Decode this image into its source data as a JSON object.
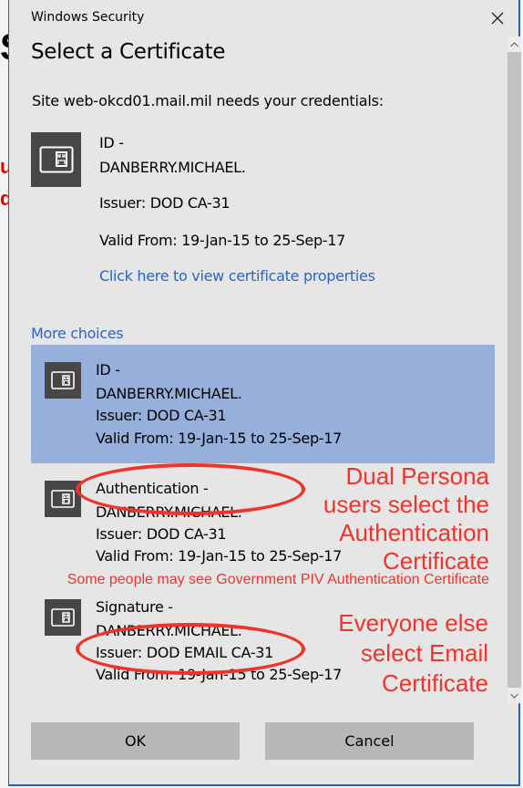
{
  "window": {
    "title": "Windows Security",
    "close_icon": "close-icon"
  },
  "dialog": {
    "heading": "Select a Certificate",
    "site_message": "Site web-okcd01.mail.mil needs your credentials:"
  },
  "primary_certificate": {
    "icon": "smart-card-icon",
    "type_line": "ID -",
    "name": "DANBERRY.MICHAEL.",
    "issuer": "Issuer: DOD CA-31",
    "valid": "Valid From: 19-Jan-15 to 25-Sep-17",
    "properties_link": "Click here to view certificate properties"
  },
  "more_choices": {
    "label": "More choices",
    "items": [
      {
        "icon": "smart-card-icon",
        "type_line": "ID -",
        "name": "DANBERRY.MICHAEL.",
        "issuer": "Issuer: DOD CA-31",
        "valid": "Valid From: 19-Jan-15 to 25-Sep-17",
        "selected": true
      },
      {
        "icon": "smart-card-icon",
        "type_line": "Authentication -",
        "name": "DANBERRY.MICHAEL.",
        "issuer": "Issuer: DOD CA-31",
        "valid": "Valid From: 19-Jan-15 to 25-Sep-17",
        "selected": false
      },
      {
        "icon": "smart-card-icon",
        "type_line": "Signature -",
        "name": "DANBERRY.MICHAEL.",
        "issuer": "Issuer: DOD EMAIL CA-31",
        "valid": "Valid From: 19-Jan-15 to 25-Sep-17",
        "selected": false
      }
    ]
  },
  "buttons": {
    "ok": "OK",
    "cancel": "Cancel"
  },
  "annotations": {
    "dual_persona": [
      "Dual Persona",
      "users select the",
      "Authentication",
      "Certificate"
    ],
    "piv_note": "Some people may see Government PIV Authentication Certificate",
    "everyone_else": [
      "Everyone else",
      "select Email",
      "Certificate"
    ],
    "color": "#f2332c"
  },
  "colors": {
    "dialog_bg": "#e6e6e6",
    "selected_bg": "#97afdb",
    "link": "#2b64c9",
    "button_bg": "#b7b7b7",
    "icon_bg": "#474747",
    "border": "#2b5fbf"
  }
}
